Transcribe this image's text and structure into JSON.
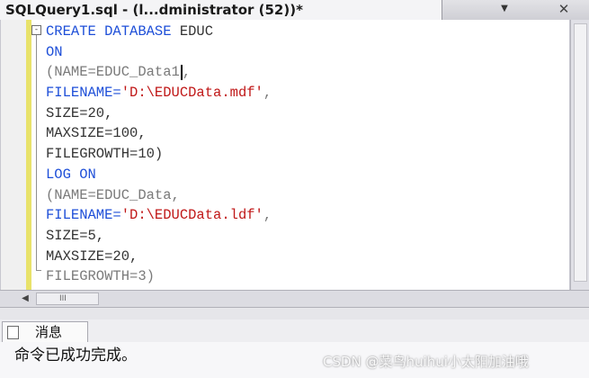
{
  "tab": {
    "title": "SQLQuery1.sql - (l...dministrator (52))*",
    "dropdown_glyph": "▼",
    "close_glyph": "✕"
  },
  "editor": {
    "outline_glyph": "-",
    "lines": [
      [
        {
          "t": "CREATE DATABASE ",
          "c": "kw"
        },
        {
          "t": "EDUC",
          "c": "tx"
        }
      ],
      [
        {
          "t": "ON",
          "c": "kw"
        }
      ],
      [
        {
          "t": "(NAME=EDUC_Data1",
          "c": "gr"
        },
        {
          "t": ",",
          "c": "gr",
          "caret": true
        }
      ],
      [
        {
          "t": "FILENAME=",
          "c": "kw"
        },
        {
          "t": "'D:\\EDUCData.mdf'",
          "c": "st"
        },
        {
          "t": ",",
          "c": "gr"
        }
      ],
      [
        {
          "t": "SIZE=20,",
          "c": "tx"
        }
      ],
      [
        {
          "t": "MAXSIZE=100,",
          "c": "tx"
        }
      ],
      [
        {
          "t": "FILEGROWTH=10)",
          "c": "tx"
        }
      ],
      [
        {
          "t": "LOG ON",
          "c": "kw"
        }
      ],
      [
        {
          "t": "(NAME=EDUC_Data,",
          "c": "gr"
        }
      ],
      [
        {
          "t": "FILENAME=",
          "c": "kw"
        },
        {
          "t": "'D:\\EDUCData.ldf'",
          "c": "st"
        },
        {
          "t": ",",
          "c": "gr"
        }
      ],
      [
        {
          "t": "SIZE=5,",
          "c": "tx"
        }
      ],
      [
        {
          "t": "MAXSIZE=20,",
          "c": "tx"
        }
      ],
      [
        {
          "t": "FILEGROWTH=3)",
          "c": "gr"
        }
      ]
    ]
  },
  "scrollbar": {
    "left_glyph": "◀",
    "grip_glyph": "III"
  },
  "messages": {
    "tab_label": "消息",
    "text": "命令已成功完成。"
  },
  "watermark": "CSDN @菜鸟huihui小太阳加油哦",
  "colors": {
    "keyword": "#1e4fd8",
    "string": "#c01818",
    "gray": "#7a7a7a",
    "text": "#333333",
    "change_bar": "#e8e26a"
  }
}
